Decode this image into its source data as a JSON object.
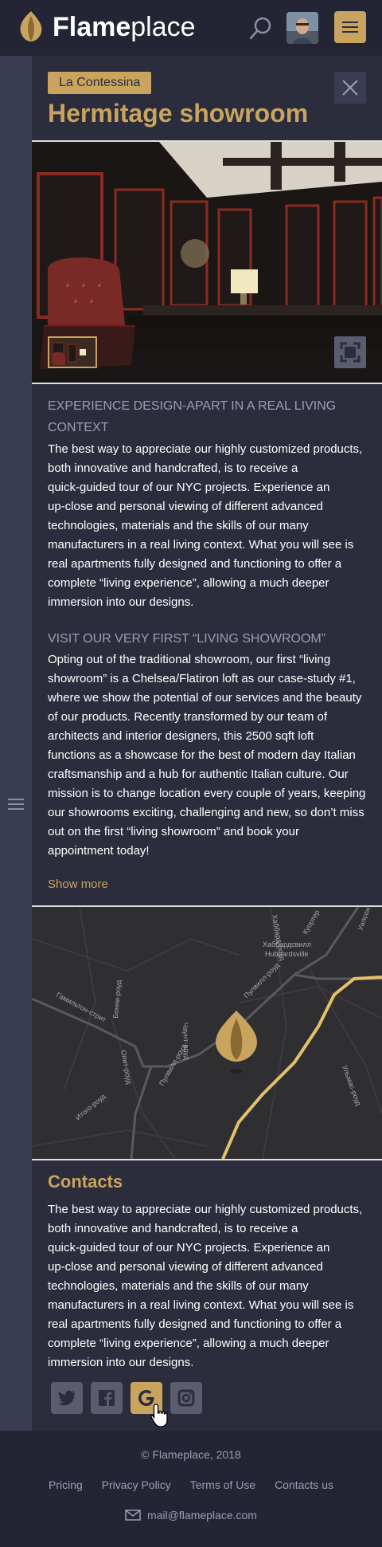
{
  "header": {
    "logo_bold": "Flame",
    "logo_light": "place"
  },
  "showroom": {
    "tag": "La Contessina",
    "title": "Hermitage showroom"
  },
  "sections": [
    {
      "heading": "EXPERIENCE DESIGN-APART IN A REAL LIVING CONTEXT",
      "lines": [
        "The best way to appreciate our highly customized products,",
        "both innovative and handcrafted, is to receive a",
        "quick-guided tour of our NYC projects. Experience an",
        "up-close and personal viewing of different advanced",
        "technologies, materials and the skills of our many",
        "manufacturers in a real living context. What you will see is",
        "real apartments fully designed and functioning to offer a",
        "complete “living experience”, allowing a much deeper",
        "immersion into our designs."
      ]
    },
    {
      "heading": "VISIT OUR VERY FIRST “LIVING SHOWROOM”",
      "lines": [
        "Opting out of the traditional showroom, our first “living",
        "showroom” is a Chelsea/Flatiron loft as our case-study #1,",
        "where we show the potential of our services and the beauty",
        "of our products. Recently transformed by our team of",
        "architects and interior designers, this 2500 sqft loft",
        "functions as a showcase for the best of modern day Italian",
        "craftsmanship and a hub for authentic Italian culture. Our",
        "mission is to change location every couple of years, keeping",
        "our showrooms exciting, challenging and new, so don’t miss",
        "out on the first “living showroom” and book your",
        "appointment today!"
      ]
    }
  ],
  "show_more": "Show more",
  "map": {
    "labels": [
      "Хаббардсвилл",
      "Hubbardsville",
      "Гамильтон-стрит",
      "Пулвилл-роуд",
      "Пулвилл-роуд",
      "Куортер",
      "Бонни-роуд",
      "Опит-роуд",
      "Чаунт-роуд",
      "Итого-роуд",
      "Ульмас-роуд",
      "Уилсон",
      "Хаббард-роуд"
    ]
  },
  "contacts": {
    "title": "Contacts",
    "lines": [
      "The best way to appreciate our highly customized products,",
      "both innovative and handcrafted, is to receive a",
      "quick-guided tour of our NYC projects. Experience an",
      "up-close and personal viewing of different advanced",
      "technologies, materials and the skills of our many",
      "manufacturers in a real living context. What you will see is",
      "real apartments fully designed and functioning to offer a",
      "complete “living experience”, allowing a much deeper",
      "immersion into our designs."
    ]
  },
  "social": [
    {
      "icon": "twitter-icon"
    },
    {
      "icon": "facebook-icon"
    },
    {
      "icon": "google-icon"
    },
    {
      "icon": "instagram-icon"
    }
  ],
  "footer": {
    "copyright": "© Flameplace, 2018",
    "links": [
      "Pricing",
      "Privacy Policy",
      "Terms of Use",
      "Contacts us"
    ],
    "email": "mail@flameplace.com"
  },
  "colors": {
    "accent": "#c9a45e",
    "background": "#2b2d3c",
    "header": "#232535"
  }
}
